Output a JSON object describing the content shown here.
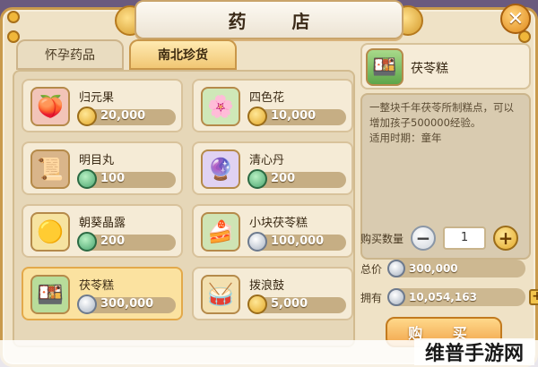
{
  "window": {
    "title": "药 店",
    "close_label": "✕"
  },
  "tabs": [
    {
      "label": "怀孕药品",
      "active": false
    },
    {
      "label": "南北珍货",
      "active": true
    }
  ],
  "items": [
    {
      "name": "归元果",
      "price": "20,000",
      "currency": "gold",
      "icon": "peach-fruit-icon",
      "glyph": "🍑",
      "bg": "#f2c4b8"
    },
    {
      "name": "四色花",
      "price": "10,000",
      "currency": "gold",
      "icon": "four-color-flower-icon",
      "glyph": "🌸",
      "bg": "#cfe8b8"
    },
    {
      "name": "明目丸",
      "price": "100",
      "currency": "jade",
      "icon": "scroll-pill-icon",
      "glyph": "📜",
      "bg": "#d9b58a"
    },
    {
      "name": "清心丹",
      "price": "200",
      "currency": "jade",
      "icon": "clear-heart-pill-icon",
      "glyph": "🔮",
      "bg": "#e0d2f2"
    },
    {
      "name": "朝葵晶露",
      "price": "200",
      "currency": "jade",
      "icon": "sunflower-dew-icon",
      "glyph": "🟡",
      "bg": "#f6e3a0"
    },
    {
      "name": "小块茯苓糕",
      "price": "100,000",
      "currency": "silver",
      "icon": "small-poria-cake-icon",
      "glyph": "🍰",
      "bg": "#cfe4b4"
    },
    {
      "name": "茯苓糕",
      "price": "300,000",
      "currency": "silver",
      "icon": "poria-cake-icon",
      "glyph": "🍱",
      "bg": "#b8dc9a",
      "selected": true
    },
    {
      "name": "拨浪鼓",
      "price": "5,000",
      "currency": "gold",
      "icon": "rattle-drum-icon",
      "glyph": "🥁",
      "bg": "#f3e0b0"
    }
  ],
  "detail": {
    "name": "茯苓糕",
    "glyph": "🍱",
    "description": "一整块千年茯苓所制糕点，可以增加孩子500000经验。",
    "period": "适用时期：童年",
    "qty_label": "购买数量",
    "qty_value": "1",
    "minus": "−",
    "plus": "+",
    "total_label": "总价",
    "total_value": "300,000",
    "own_label": "拥有",
    "own_value": "10,054,163",
    "buy_label": "购 买"
  },
  "watermark": "维普手游网"
}
